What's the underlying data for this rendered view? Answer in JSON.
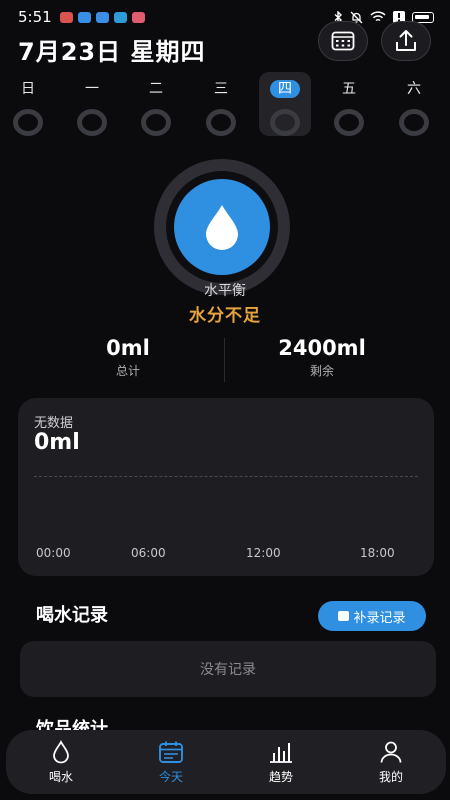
{
  "status": {
    "time": "5:51"
  },
  "header": {
    "date": "7月23日 星期四"
  },
  "week": [
    {
      "label": "日",
      "selected": false
    },
    {
      "label": "一",
      "selected": false
    },
    {
      "label": "二",
      "selected": false
    },
    {
      "label": "三",
      "selected": false
    },
    {
      "label": "四",
      "selected": true
    },
    {
      "label": "五",
      "selected": false
    },
    {
      "label": "六",
      "selected": false
    }
  ],
  "balance": {
    "label": "水平衡",
    "status": "水分不足"
  },
  "totals": {
    "consumed_value": "0ml",
    "consumed_label": "总计",
    "remaining_value": "2400ml",
    "remaining_label": "剩余"
  },
  "chart": {
    "title": "无数据",
    "value": "0ml",
    "ticks": [
      "00:00",
      "06:00",
      "12:00",
      "18:00"
    ]
  },
  "records": {
    "title": "喝水记录",
    "add_label": "补录记录",
    "empty": "没有记录"
  },
  "next_section": {
    "title": "饮品统计"
  },
  "nav": [
    {
      "label": "喝水",
      "icon": "drop-icon",
      "active": false
    },
    {
      "label": "今天",
      "icon": "calendar-icon",
      "active": true
    },
    {
      "label": "趋势",
      "icon": "bar-chart-icon",
      "active": false
    },
    {
      "label": "我的",
      "icon": "person-icon",
      "active": false
    }
  ],
  "colors": {
    "accent": "#2f8fe0",
    "warning": "#e6a33e",
    "background": "#0b0b0e",
    "card": "#1d1d22"
  }
}
